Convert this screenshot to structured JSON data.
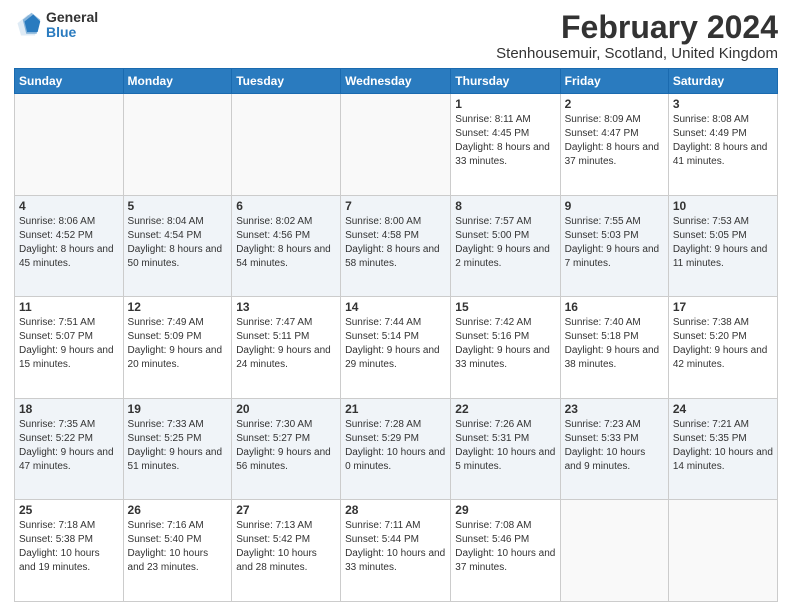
{
  "logo": {
    "general": "General",
    "blue": "Blue"
  },
  "title": "February 2024",
  "subtitle": "Stenhousemuir, Scotland, United Kingdom",
  "days_of_week": [
    "Sunday",
    "Monday",
    "Tuesday",
    "Wednesday",
    "Thursday",
    "Friday",
    "Saturday"
  ],
  "weeks": [
    [
      {
        "day": "",
        "info": ""
      },
      {
        "day": "",
        "info": ""
      },
      {
        "day": "",
        "info": ""
      },
      {
        "day": "",
        "info": ""
      },
      {
        "day": "1",
        "info": "Sunrise: 8:11 AM\nSunset: 4:45 PM\nDaylight: 8 hours and 33 minutes."
      },
      {
        "day": "2",
        "info": "Sunrise: 8:09 AM\nSunset: 4:47 PM\nDaylight: 8 hours and 37 minutes."
      },
      {
        "day": "3",
        "info": "Sunrise: 8:08 AM\nSunset: 4:49 PM\nDaylight: 8 hours and 41 minutes."
      }
    ],
    [
      {
        "day": "4",
        "info": "Sunrise: 8:06 AM\nSunset: 4:52 PM\nDaylight: 8 hours and 45 minutes."
      },
      {
        "day": "5",
        "info": "Sunrise: 8:04 AM\nSunset: 4:54 PM\nDaylight: 8 hours and 50 minutes."
      },
      {
        "day": "6",
        "info": "Sunrise: 8:02 AM\nSunset: 4:56 PM\nDaylight: 8 hours and 54 minutes."
      },
      {
        "day": "7",
        "info": "Sunrise: 8:00 AM\nSunset: 4:58 PM\nDaylight: 8 hours and 58 minutes."
      },
      {
        "day": "8",
        "info": "Sunrise: 7:57 AM\nSunset: 5:00 PM\nDaylight: 9 hours and 2 minutes."
      },
      {
        "day": "9",
        "info": "Sunrise: 7:55 AM\nSunset: 5:03 PM\nDaylight: 9 hours and 7 minutes."
      },
      {
        "day": "10",
        "info": "Sunrise: 7:53 AM\nSunset: 5:05 PM\nDaylight: 9 hours and 11 minutes."
      }
    ],
    [
      {
        "day": "11",
        "info": "Sunrise: 7:51 AM\nSunset: 5:07 PM\nDaylight: 9 hours and 15 minutes."
      },
      {
        "day": "12",
        "info": "Sunrise: 7:49 AM\nSunset: 5:09 PM\nDaylight: 9 hours and 20 minutes."
      },
      {
        "day": "13",
        "info": "Sunrise: 7:47 AM\nSunset: 5:11 PM\nDaylight: 9 hours and 24 minutes."
      },
      {
        "day": "14",
        "info": "Sunrise: 7:44 AM\nSunset: 5:14 PM\nDaylight: 9 hours and 29 minutes."
      },
      {
        "day": "15",
        "info": "Sunrise: 7:42 AM\nSunset: 5:16 PM\nDaylight: 9 hours and 33 minutes."
      },
      {
        "day": "16",
        "info": "Sunrise: 7:40 AM\nSunset: 5:18 PM\nDaylight: 9 hours and 38 minutes."
      },
      {
        "day": "17",
        "info": "Sunrise: 7:38 AM\nSunset: 5:20 PM\nDaylight: 9 hours and 42 minutes."
      }
    ],
    [
      {
        "day": "18",
        "info": "Sunrise: 7:35 AM\nSunset: 5:22 PM\nDaylight: 9 hours and 47 minutes."
      },
      {
        "day": "19",
        "info": "Sunrise: 7:33 AM\nSunset: 5:25 PM\nDaylight: 9 hours and 51 minutes."
      },
      {
        "day": "20",
        "info": "Sunrise: 7:30 AM\nSunset: 5:27 PM\nDaylight: 9 hours and 56 minutes."
      },
      {
        "day": "21",
        "info": "Sunrise: 7:28 AM\nSunset: 5:29 PM\nDaylight: 10 hours and 0 minutes."
      },
      {
        "day": "22",
        "info": "Sunrise: 7:26 AM\nSunset: 5:31 PM\nDaylight: 10 hours and 5 minutes."
      },
      {
        "day": "23",
        "info": "Sunrise: 7:23 AM\nSunset: 5:33 PM\nDaylight: 10 hours and 9 minutes."
      },
      {
        "day": "24",
        "info": "Sunrise: 7:21 AM\nSunset: 5:35 PM\nDaylight: 10 hours and 14 minutes."
      }
    ],
    [
      {
        "day": "25",
        "info": "Sunrise: 7:18 AM\nSunset: 5:38 PM\nDaylight: 10 hours and 19 minutes."
      },
      {
        "day": "26",
        "info": "Sunrise: 7:16 AM\nSunset: 5:40 PM\nDaylight: 10 hours and 23 minutes."
      },
      {
        "day": "27",
        "info": "Sunrise: 7:13 AM\nSunset: 5:42 PM\nDaylight: 10 hours and 28 minutes."
      },
      {
        "day": "28",
        "info": "Sunrise: 7:11 AM\nSunset: 5:44 PM\nDaylight: 10 hours and 33 minutes."
      },
      {
        "day": "29",
        "info": "Sunrise: 7:08 AM\nSunset: 5:46 PM\nDaylight: 10 hours and 37 minutes."
      },
      {
        "day": "",
        "info": ""
      },
      {
        "day": "",
        "info": ""
      }
    ]
  ]
}
